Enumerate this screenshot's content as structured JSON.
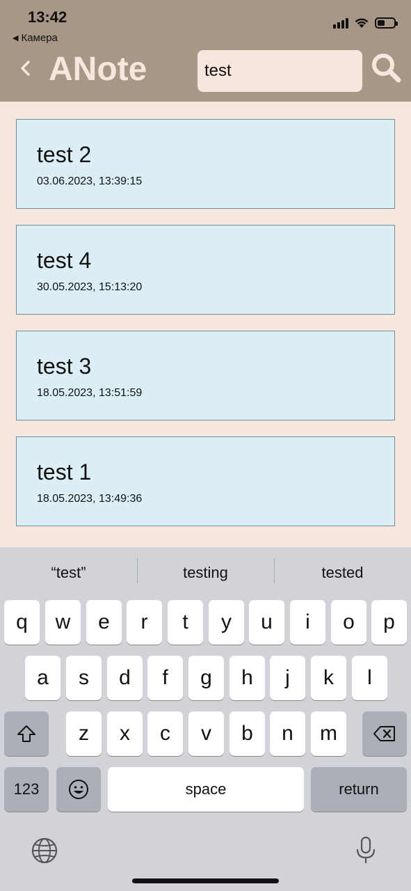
{
  "status_bar": {
    "time": "13:42",
    "back_app": "Камера"
  },
  "header": {
    "title": "ANote",
    "search_value": "test"
  },
  "notes": [
    {
      "title": "test 2",
      "date": "03.06.2023, 13:39:15"
    },
    {
      "title": "test 4",
      "date": "30.05.2023, 15:13:20"
    },
    {
      "title": "test 3",
      "date": "18.05.2023, 13:51:59"
    },
    {
      "title": "test 1",
      "date": "18.05.2023, 13:49:36"
    }
  ],
  "keyboard": {
    "suggestions": [
      "“test”",
      "testing",
      "tested"
    ],
    "row1": [
      "q",
      "w",
      "e",
      "r",
      "t",
      "y",
      "u",
      "i",
      "o",
      "p"
    ],
    "row2": [
      "a",
      "s",
      "d",
      "f",
      "g",
      "h",
      "j",
      "k",
      "l"
    ],
    "row3": [
      "z",
      "x",
      "c",
      "v",
      "b",
      "n",
      "m"
    ],
    "numbers_label": "123",
    "space_label": "space",
    "return_label": "return"
  },
  "colors": {
    "header_bg": "#a89686",
    "page_bg": "#f5e7dd",
    "note_bg": "#dbeef4",
    "keyboard_bg": "#d1d3d9"
  }
}
